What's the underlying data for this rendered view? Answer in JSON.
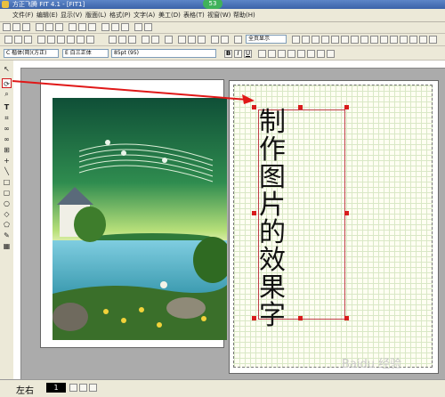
{
  "window": {
    "title": "方正飞腾 FIT 4.1 - [FIT1]",
    "badge": "53"
  },
  "menu": [
    "文件(F)",
    "编辑(E)",
    "显示(V)",
    "版面(L)",
    "格式(P)",
    "文字(A)",
    "美工(D)",
    "表格(T)",
    "视窗(W)",
    "帮助(H)"
  ],
  "toolbar": {
    "zoom": "全页显示",
    "font_prefix": "C",
    "font_name": "楷体(简)(方正)",
    "font_prefix2": "E",
    "font_name2": "白三正体",
    "size": "85pt (95)"
  },
  "format_buttons": [
    "B",
    "I",
    "U"
  ],
  "canvas": {
    "text": "制作图片的效果字"
  },
  "status": {
    "page_labels": [
      "左右",
      "1"
    ]
  },
  "watermark": "Baidu 经验",
  "colors": {
    "selection": "#d81c1c",
    "frame": "#c0404a",
    "grid": "#d9e8c6"
  }
}
